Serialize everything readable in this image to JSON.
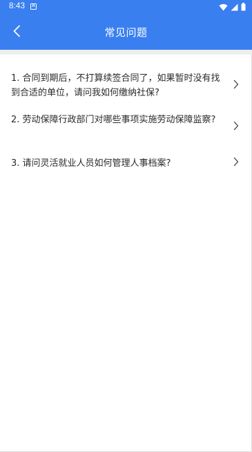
{
  "status_bar": {
    "time": "8:43",
    "notification_badge": "A",
    "icons": [
      "wifi-icon",
      "cellular-signal-icon",
      "battery-icon"
    ]
  },
  "header": {
    "title": "常见问题",
    "back_icon": "back-arrow-icon"
  },
  "faq": {
    "items": [
      {
        "text": "1. 合同到期后，不打算续签合同了，如果暂时没有找到合适的单位，请问我如何缴纳社保?"
      },
      {
        "text": "2. 劳动保障行政部门对哪些事项实施劳动保障监察?"
      },
      {
        "text": "3. 请问灵活就业人员如何管理人事档案?"
      }
    ]
  },
  "colors": {
    "primary": "#3a7ff0",
    "text": "#2a2a2a",
    "chevron": "#555555",
    "divider": "#eeeeef"
  }
}
